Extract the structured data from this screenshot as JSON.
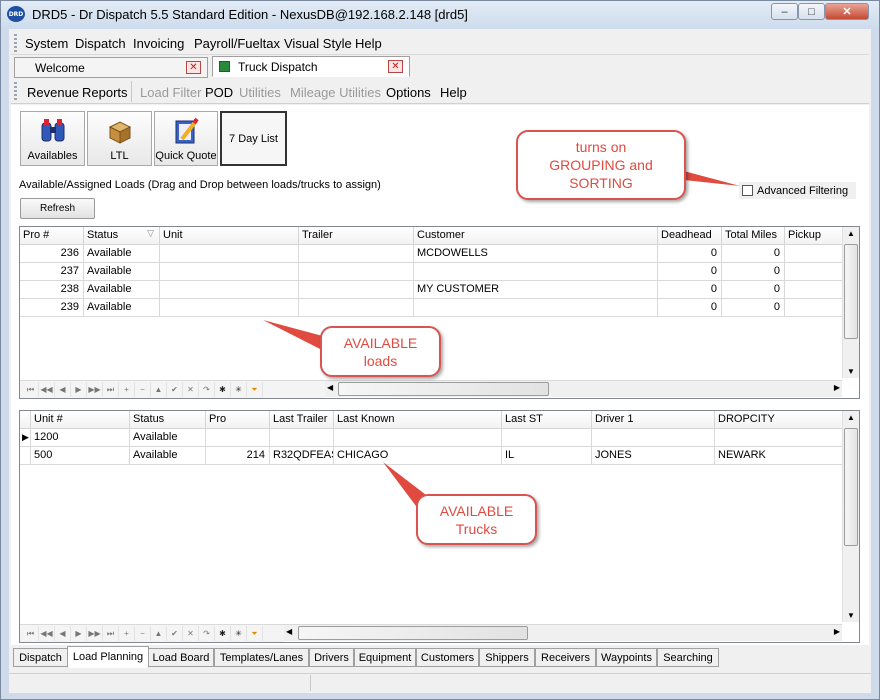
{
  "window": {
    "title": "DRD5 - Dr Dispatch 5.5 Standard Edition - NexusDB@192.168.2.148 [drd5]",
    "app_icon": "DRD",
    "min": "–",
    "max": "□",
    "close": "✕"
  },
  "menu": [
    "System",
    "Dispatch",
    "Invoicing",
    "Payroll/Fueltax",
    "Visual Style",
    "Help"
  ],
  "doc_tabs": [
    {
      "label": "Welcome"
    },
    {
      "label": "Truck Dispatch"
    }
  ],
  "toolbar": {
    "items": [
      {
        "label": "Revenue",
        "enabled": true
      },
      {
        "label": "Reports",
        "enabled": true
      },
      {
        "label": "Load Filter",
        "enabled": false
      },
      {
        "label": "POD",
        "enabled": true
      },
      {
        "label": "Utilities",
        "enabled": false
      },
      {
        "label": "Mileage Utilities",
        "enabled": false
      },
      {
        "label": "Options",
        "enabled": true
      },
      {
        "label": "Help",
        "enabled": true
      }
    ]
  },
  "big_buttons": [
    {
      "label": "Availables",
      "icon": "binoculars-icon"
    },
    {
      "label": "LTL",
      "icon": "box-icon"
    },
    {
      "label": "Quick Quote",
      "icon": "notepad-pencil-icon"
    },
    {
      "label": "7 Day List"
    }
  ],
  "loads_caption": "Available/Assigned Loads (Drag and Drop between loads/trucks to assign)",
  "refresh_label": "Refresh",
  "advanced_filtering_label": "Advanced Filtering",
  "loads_grid": {
    "columns": [
      "Pro #",
      "Status",
      "Unit",
      "Trailer",
      "Customer",
      "Deadhead",
      "Total Miles",
      "Pickup"
    ],
    "rows": [
      {
        "pro": "236",
        "status": "Available",
        "unit": "",
        "trailer": "",
        "customer": "MCDOWELLS",
        "deadhead": "0",
        "miles": "0",
        "pickup": ""
      },
      {
        "pro": "237",
        "status": "Available",
        "unit": "",
        "trailer": "",
        "customer": "",
        "deadhead": "0",
        "miles": "0",
        "pickup": ""
      },
      {
        "pro": "238",
        "status": "Available",
        "unit": "",
        "trailer": "",
        "customer": "MY CUSTOMER",
        "deadhead": "0",
        "miles": "0",
        "pickup": ""
      },
      {
        "pro": "239",
        "status": "Available",
        "unit": "",
        "trailer": "",
        "customer": "",
        "deadhead": "0",
        "miles": "0",
        "pickup": ""
      }
    ]
  },
  "trucks_grid": {
    "columns": [
      "Unit #",
      "Status",
      "Pro",
      "Last Trailer",
      "Last Known",
      "Last ST",
      "Driver 1",
      "DROPCITY"
    ],
    "rows": [
      {
        "unit": "1200",
        "status": "Available",
        "pro": "",
        "trailer": "",
        "known": "",
        "st": "",
        "driver": "",
        "dropcity": ""
      },
      {
        "unit": "500",
        "status": "Available",
        "pro": "214",
        "trailer": "R32QDFEAS",
        "known": "CHICAGO",
        "st": "IL",
        "driver": "JONES",
        "dropcity": "NEWARK"
      }
    ]
  },
  "nav_buttons": [
    "⏮",
    "◀◀",
    "◀",
    "▶",
    "▶▶",
    "⏭",
    "+",
    "−",
    "▲",
    "✔",
    "✕",
    "↷",
    "✱",
    "✳",
    "⏷"
  ],
  "bottom_tabs": [
    "Dispatch",
    "Load Planning",
    "Load Board",
    "Templates/Lanes",
    "Drivers",
    "Equipment",
    "Customers",
    "Shippers",
    "Receivers",
    "Waypoints",
    "Searching"
  ],
  "callouts": {
    "grouping": "turns on\nGROUPING and\nSORTING",
    "loads": "AVAILABLE\nloads",
    "trucks": "AVAILABLE\nTrucks"
  },
  "colors": {
    "callout": "#e04a3f",
    "frame": "#cfdbea"
  }
}
